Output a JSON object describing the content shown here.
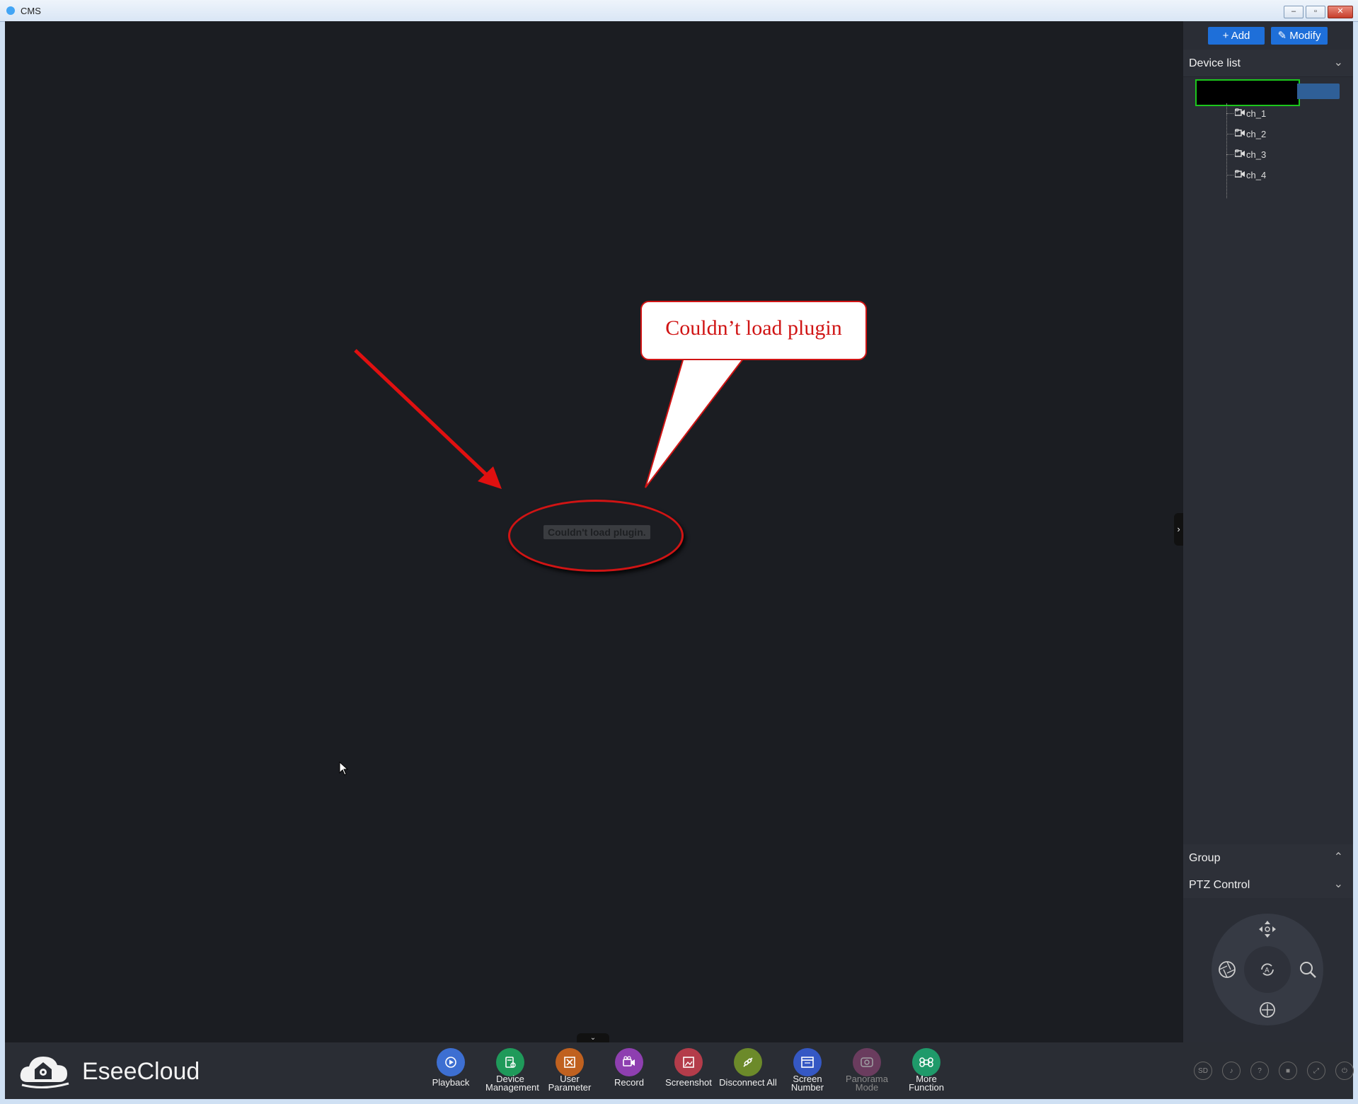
{
  "window": {
    "title": "CMS",
    "min": "–",
    "max": "▫",
    "close": "✕"
  },
  "video": {
    "plugin_message": "Couldn't load plugin.",
    "callout_text": "Couldn’t load plugin",
    "expand_glyph": "⌄",
    "side_glyph": "›"
  },
  "panel": {
    "add_label": "+ Add",
    "modify_label": "Modify",
    "device_list_label": "Device list",
    "channels": [
      "ch_1",
      "ch_2",
      "ch_3",
      "ch_4"
    ],
    "group_label": "Group",
    "ptz_label": "PTZ Control",
    "chev_down": "⌄",
    "chev_up": "⌃"
  },
  "brand": {
    "name": "EseeCloud"
  },
  "toolbar": [
    {
      "label": "Playback",
      "icon": "playback-icon",
      "color": "#3d6fd2",
      "enabled": true
    },
    {
      "label": "Device Management",
      "icon": "device-management-icon",
      "color": "#1f9a5a",
      "enabled": true
    },
    {
      "label": "User Parameter",
      "icon": "user-parameter-icon",
      "color": "#c0611f",
      "enabled": true
    },
    {
      "label": "Record",
      "icon": "record-icon",
      "color": "#8e3fb0",
      "enabled": true
    },
    {
      "label": "Screenshot",
      "icon": "screenshot-icon",
      "color": "#b43c4a",
      "enabled": true
    },
    {
      "label": "Disconnect All",
      "icon": "disconnect-icon",
      "color": "#6c8a2a",
      "enabled": true
    },
    {
      "label": "Screen Number",
      "icon": "screen-number-icon",
      "color": "#3558c4",
      "enabled": true
    },
    {
      "label": "Panorama Mode",
      "icon": "panorama-icon",
      "color": "#a04a82",
      "enabled": false
    },
    {
      "label": "More Function",
      "icon": "more-function-icon",
      "color": "#1f9a6a",
      "enabled": true
    }
  ],
  "system_icons": [
    {
      "icon": "sd-icon",
      "text": "SD"
    },
    {
      "icon": "volume-icon",
      "text": "♪"
    },
    {
      "icon": "help-icon",
      "text": "?"
    },
    {
      "icon": "camera-icon",
      "text": "■"
    },
    {
      "icon": "fullscreen-icon",
      "text": "⤢"
    },
    {
      "icon": "power-icon",
      "text": "⏻"
    }
  ]
}
